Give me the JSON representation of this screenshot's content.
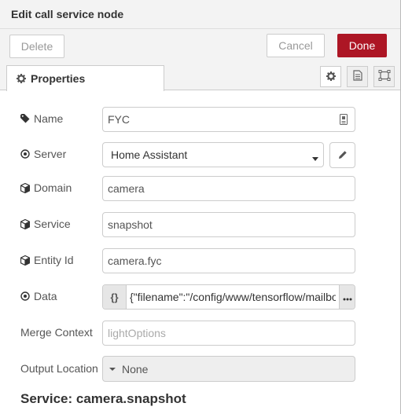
{
  "dialog": {
    "title": "Edit call service node"
  },
  "toolbar": {
    "delete_label": "Delete",
    "cancel_label": "Cancel",
    "done_label": "Done",
    "done_color": "#ad1625"
  },
  "tabs": {
    "properties_label": "Properties",
    "icons": [
      "gear-icon",
      "description-icon",
      "appearance-icon"
    ]
  },
  "form": {
    "name": {
      "label": "Name",
      "value": "FYC"
    },
    "server": {
      "label": "Server",
      "value": "Home Assistant"
    },
    "domain": {
      "label": "Domain",
      "value": "camera"
    },
    "service": {
      "label": "Service",
      "value": "snapshot"
    },
    "entity_id": {
      "label": "Entity Id",
      "value": "camera.fyc"
    },
    "data": {
      "label": "Data",
      "type_label": "{}",
      "value": "{\"filename\":\"/config/www/tensorflow/mailbox"
    },
    "merge_context": {
      "label": "Merge Context",
      "placeholder": "lightOptions"
    },
    "output_location": {
      "label": "Output Location",
      "value": "None"
    }
  },
  "service_heading": "Service: camera.snapshot"
}
